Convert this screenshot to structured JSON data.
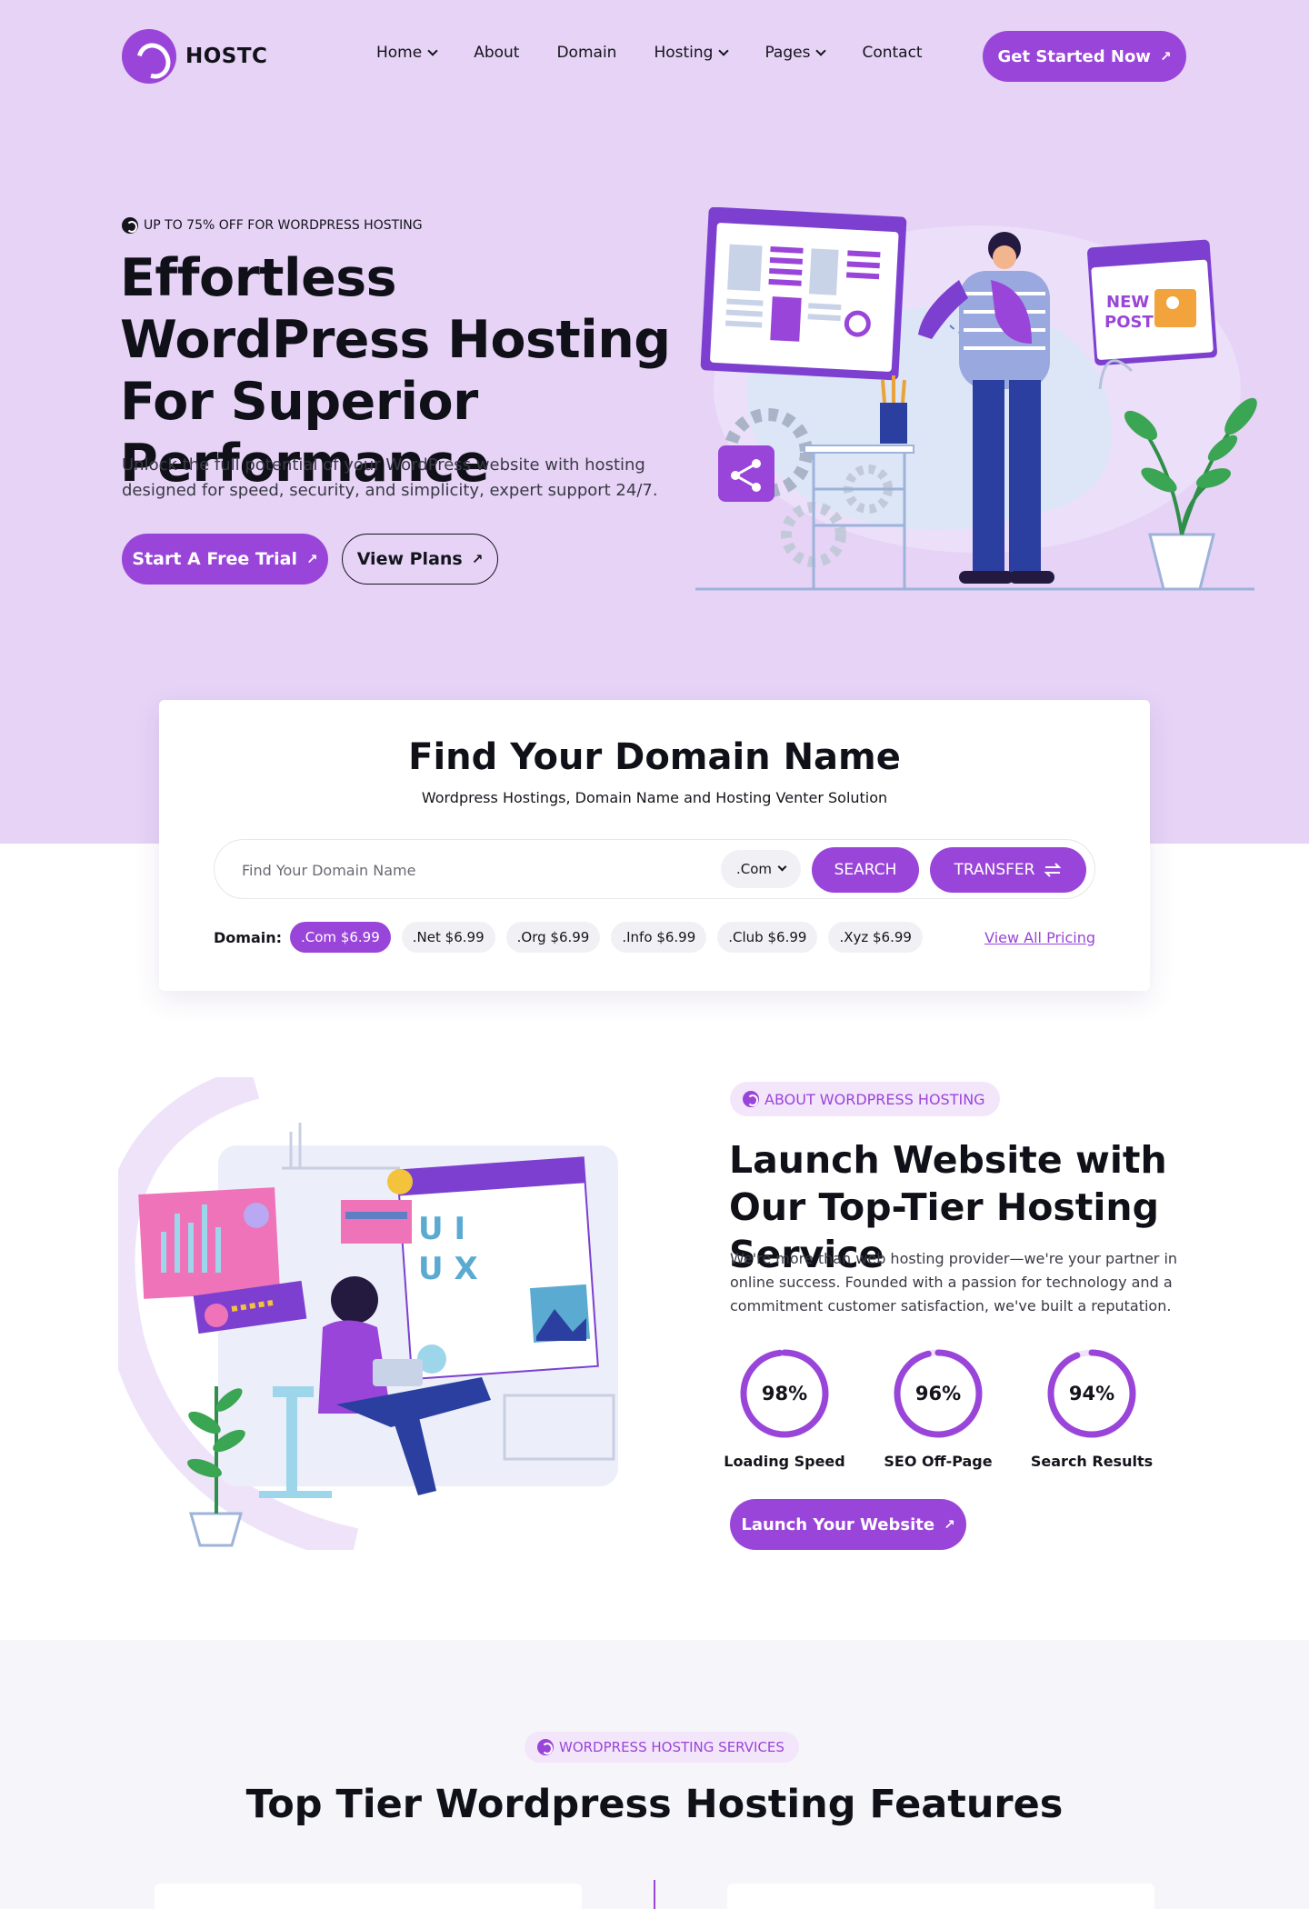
{
  "brand": {
    "name": "HOSTC",
    "accent": "#9a45d9",
    "hero_bg": "#e6d3f6"
  },
  "nav": {
    "items": [
      {
        "label": "Home",
        "dropdown": true
      },
      {
        "label": "About",
        "dropdown": false
      },
      {
        "label": "Domain",
        "dropdown": false
      },
      {
        "label": "Hosting",
        "dropdown": true
      },
      {
        "label": "Pages",
        "dropdown": true
      },
      {
        "label": "Contact",
        "dropdown": false
      }
    ],
    "cta": "Get Started Now",
    "arrow": "↗"
  },
  "hero": {
    "eyebrow": "UP TO 75% OFF FOR WORDPRESS HOSTING",
    "title": "Effortless WordPress Hosting For Superior Performance",
    "description": "Unlock the full potential of your WordPress website with hosting designed for speed, security, and simplicity, expert support 24/7.",
    "primary_button": "Start A Free Trial",
    "secondary_button": "View Plans",
    "illustration_text": [
      "NEW",
      "POST"
    ]
  },
  "domain": {
    "title": "Find Your Domain Name",
    "subtitle": "Wordpress Hostings, Domain Name and Hosting Venter Solution",
    "placeholder": "Find Your Domain Name",
    "tld_selected": ".Com",
    "search_button": "SEARCH",
    "transfer_button": "TRANSFER",
    "prices_label": "Domain:",
    "prices": [
      {
        "tld": ".Com",
        "price": "$6.99",
        "active": true
      },
      {
        "tld": ".Net",
        "price": "$6.99",
        "active": false
      },
      {
        "tld": ".Org",
        "price": "$6.99",
        "active": false
      },
      {
        "tld": ".Info",
        "price": "$6.99",
        "active": false
      },
      {
        "tld": ".Club",
        "price": "$6.99",
        "active": false
      },
      {
        "tld": ".Xyz",
        "price": "$6.99",
        "active": false
      }
    ],
    "view_all": "View All Pricing"
  },
  "about": {
    "badge": "ABOUT WORDPRESS HOSTING",
    "title": "Launch Website with Our Top-Tier Hosting Service",
    "description": "We're more than web hosting provider—we're your partner in online success. Founded with a passion for technology and a commitment customer satisfaction, we've built a reputation.",
    "stats": [
      {
        "value": "98%",
        "label": "Loading Speed",
        "percent": 98
      },
      {
        "value": "96%",
        "label": "SEO Off-Page",
        "percent": 96
      },
      {
        "value": "94%",
        "label": "Search Results",
        "percent": 94
      }
    ],
    "button": "Launch Your Website",
    "illustration_text": [
      "U I",
      "U X"
    ]
  },
  "features": {
    "badge": "WORDPRESS HOSTING SERVICES",
    "title": "Top Tier Wordpress Hosting Features"
  }
}
